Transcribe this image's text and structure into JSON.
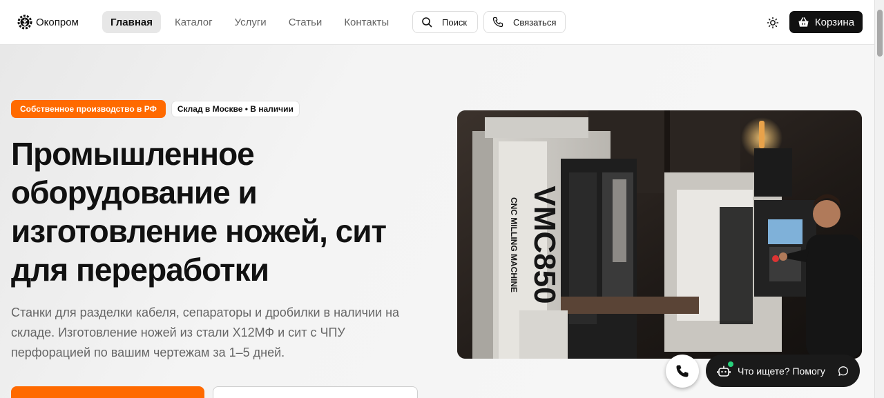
{
  "header": {
    "logo_text": "Окопром",
    "nav": [
      {
        "label": "Главная",
        "active": true
      },
      {
        "label": "Каталог",
        "active": false
      },
      {
        "label": "Услуги",
        "active": false
      },
      {
        "label": "Статьи",
        "active": false
      },
      {
        "label": "Контакты",
        "active": false
      }
    ],
    "search_label": "Поиск",
    "contact_label": "Связаться",
    "cart_label": "Корзина"
  },
  "hero": {
    "badge_primary": "Собственное производство в РФ",
    "badge_secondary": "Склад в Москве • В наличии",
    "title": "Промышленное оборудование и изготовление ножей, сит для переработки",
    "subtitle": "Станки для разделки кабеля, сепараторы и дробилки в наличии на складе. Изготовление ножей из стали Х12МФ и сит с ЧПУ перфорацией по вашим чертежам за 1–5 дней."
  },
  "photo": {
    "machine_brand": "VMC850",
    "machine_caption": "CNC MILLING MACHINE"
  },
  "widgets": {
    "help_label": "Что ищете? Помогу"
  },
  "colors": {
    "accent": "#ff6a00",
    "dark": "#111111",
    "online": "#28d17c"
  },
  "icons": [
    "logo-gear-icon",
    "search-icon",
    "phone-icon",
    "sun-icon",
    "basket-icon",
    "bot-icon",
    "chat-icon"
  ]
}
